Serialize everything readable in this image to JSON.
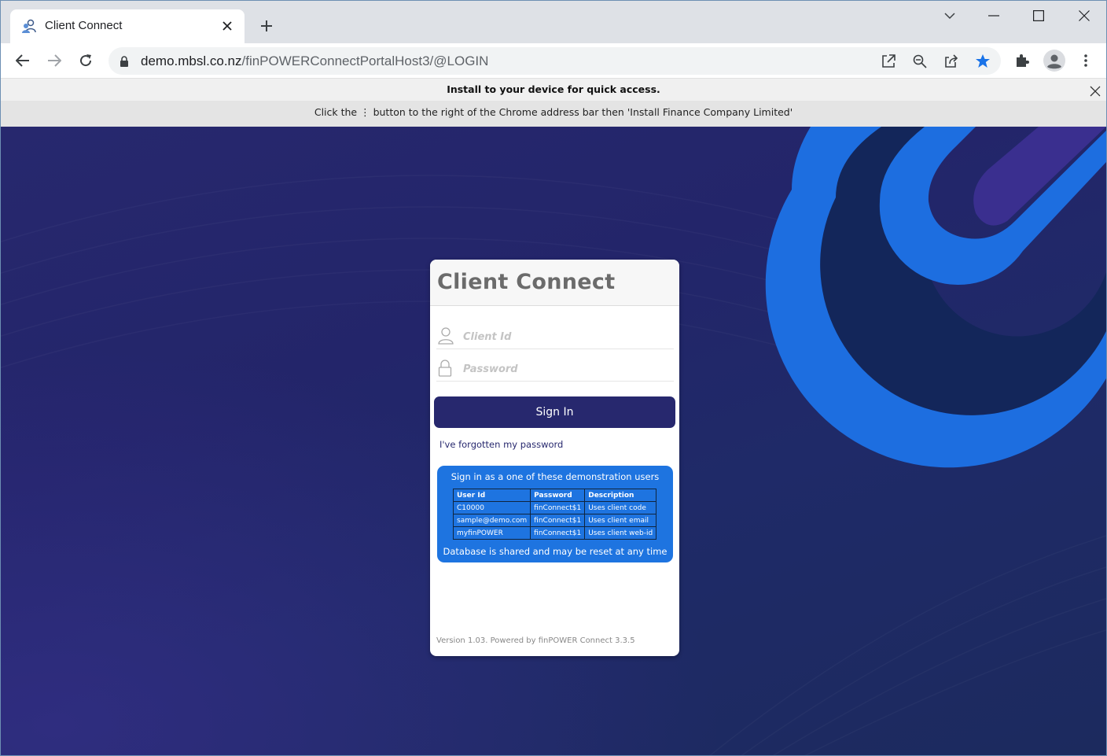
{
  "browser": {
    "tab": {
      "title": "Client Connect"
    },
    "address": {
      "host": "demo.mbsl.co.nz",
      "path": "/finPOWERConnectPortalHost3/@LOGIN"
    }
  },
  "infobar": {
    "install_msg": "Install to your device for quick access.",
    "instructions": "Click the ⋮ button to the right of the Chrome address bar then 'Install Finance Company Limited'"
  },
  "login": {
    "title": "Client Connect",
    "client_id_placeholder": "Client Id",
    "password_placeholder": "Password",
    "signin_label": "Sign In",
    "forgot_label": "I've forgotten my password"
  },
  "demo": {
    "title": "Sign in as a one of these demonstration users",
    "headers": [
      "User Id",
      "Password",
      "Description"
    ],
    "rows": [
      [
        "C10000",
        "finConnect$1",
        "Uses client code"
      ],
      [
        "sample@demo.com",
        "finConnect$1",
        "Uses client email"
      ],
      [
        "myfinPOWER",
        "finConnect$1",
        "Uses client web-id"
      ]
    ],
    "footer": "Database is shared and may be reset at any time"
  },
  "version": "Version 1.03. Powered by finPOWER Connect 3.3.5",
  "colors": {
    "brand_dark": "#27286e",
    "accent_blue": "#1e74e0",
    "star_blue": "#1a73e8"
  }
}
